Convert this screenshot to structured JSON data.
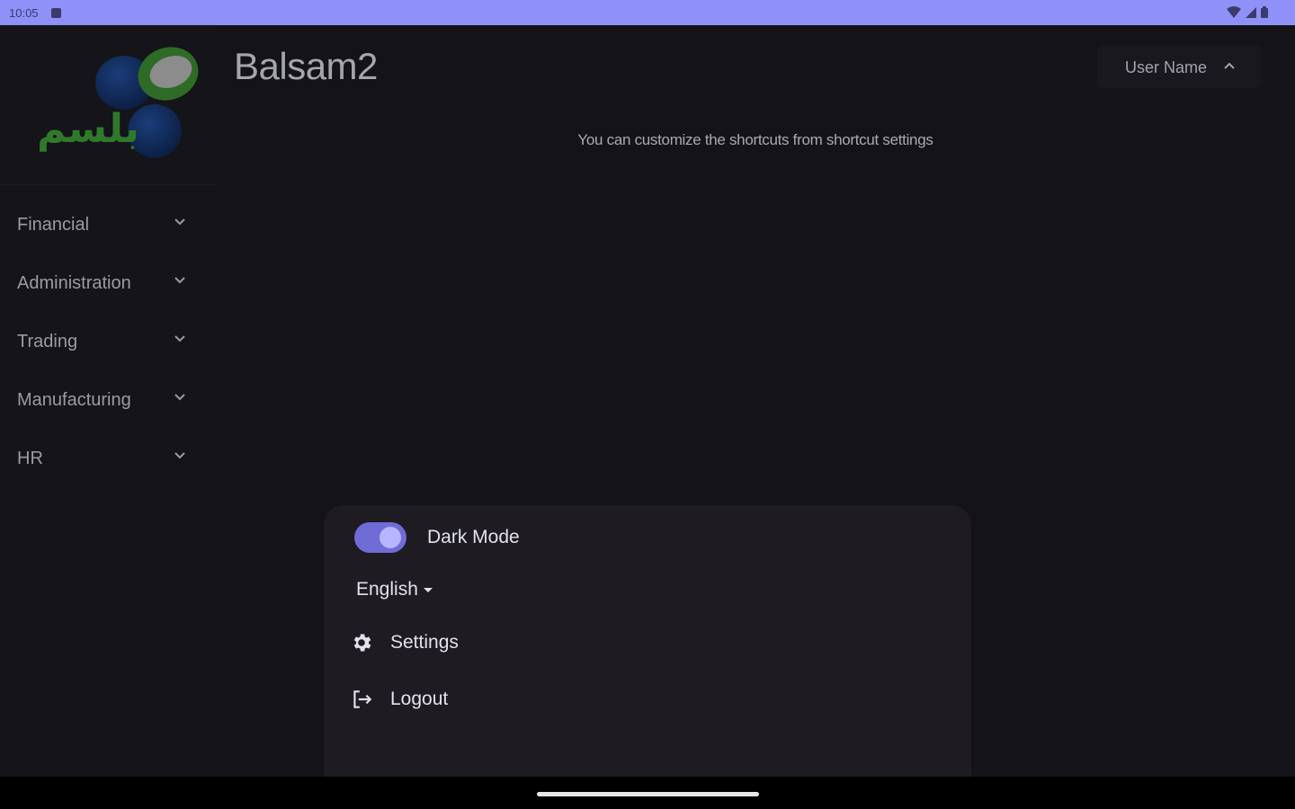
{
  "status_bar": {
    "time": "10:05"
  },
  "app": {
    "title": "Balsam2"
  },
  "sidebar": {
    "logo_text": "بلسم",
    "items": [
      {
        "label": "Financial"
      },
      {
        "label": "Administration"
      },
      {
        "label": "Trading"
      },
      {
        "label": "Manufacturing"
      },
      {
        "label": "HR"
      }
    ]
  },
  "header": {
    "user_name": "User Name"
  },
  "main": {
    "hint": "You can customize the shortcuts from shortcut settings"
  },
  "user_menu": {
    "dark_mode_label": "Dark Mode",
    "dark_mode_on": true,
    "language": "English",
    "settings_label": "Settings",
    "logout_label": "Logout"
  },
  "colors": {
    "status_bar": "#8f91f9",
    "accent": "#6f6cd6",
    "background": "#131318",
    "panel": "#1e1b22"
  }
}
